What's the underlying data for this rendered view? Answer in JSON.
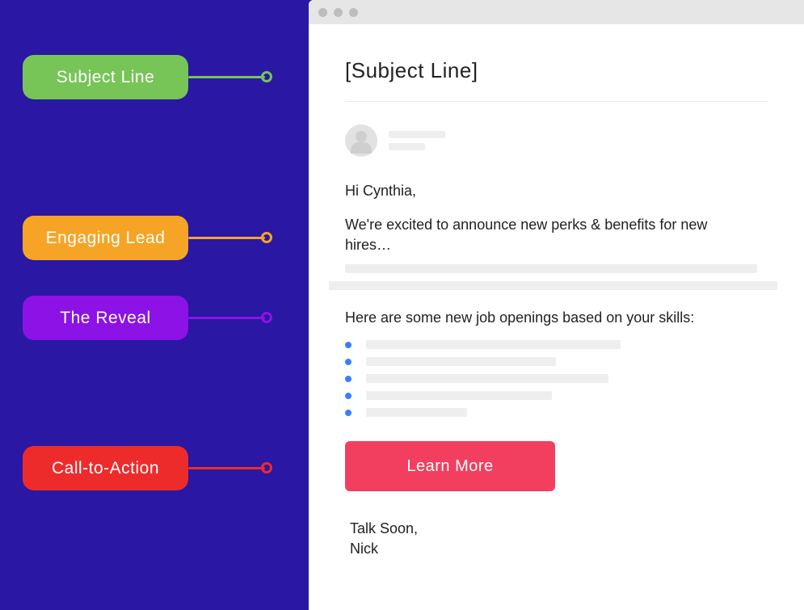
{
  "annotations": {
    "subject": "Subject Line",
    "lead": "Engaging Lead",
    "reveal": "The Reveal",
    "cta": "Call-to-Action"
  },
  "email": {
    "subject_placeholder": "[Subject Line]",
    "greeting": "Hi Cynthia,",
    "lead_paragraph": "We're excited to announce new perks & benefits for new hires…",
    "reveal_line": "Here are some new job openings based on your skills:",
    "cta_label": "Learn More",
    "signoff": "Talk Soon,",
    "sender_name": "Nick"
  },
  "colors": {
    "subject": "#77c556",
    "lead": "#f6a426",
    "reveal": "#8d12e6",
    "cta_pill": "#ee2b2b",
    "cta_btn": "#f23f5f",
    "bullet": "#3a7eff",
    "bg": "#2a17a3"
  }
}
